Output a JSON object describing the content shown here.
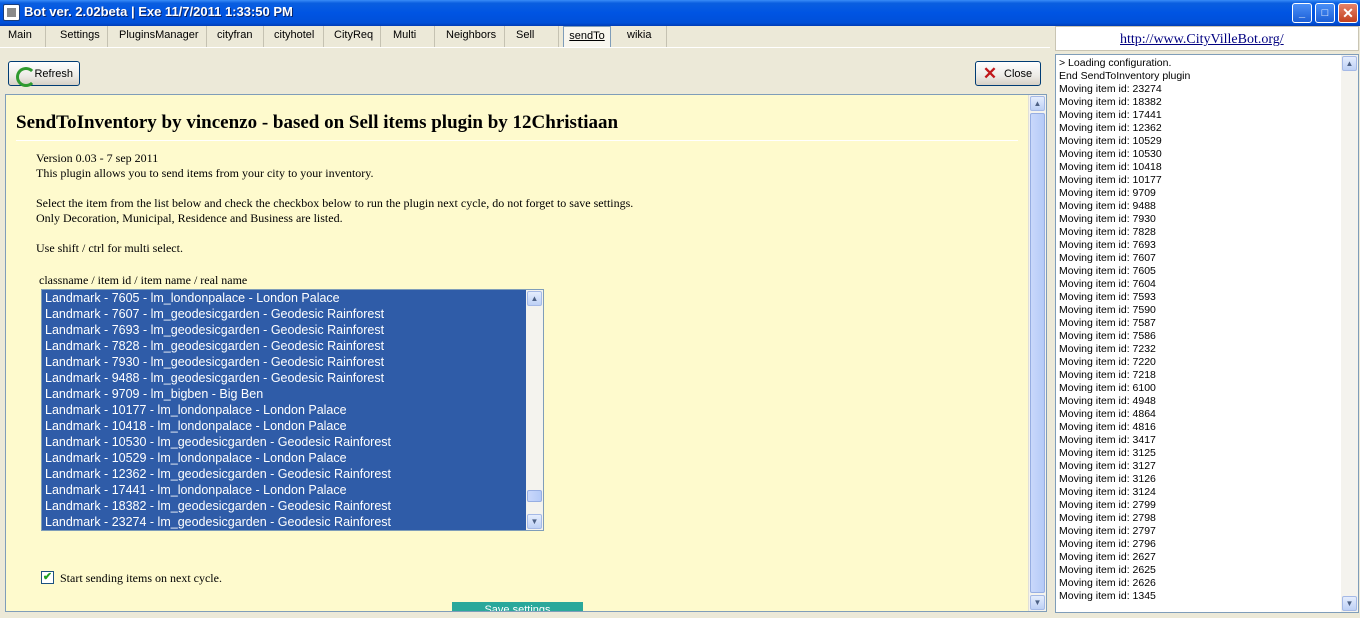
{
  "window": {
    "title": "Bot ver. 2.02beta  |  Exe 11/7/2011 1:33:50 PM",
    "minimize": "_",
    "maximize": "□",
    "close": "✕"
  },
  "tabs": [
    {
      "label": "Main"
    },
    {
      "label": "Settings"
    },
    {
      "label": "PluginsManager"
    },
    {
      "label": "cityfran"
    },
    {
      "label": "cityhotel"
    },
    {
      "label": "CityReq"
    },
    {
      "label": "Multi"
    },
    {
      "label": "Neighbors"
    },
    {
      "label": "Sell"
    },
    {
      "label": "sendTo",
      "selected": true
    },
    {
      "label": "wikia"
    }
  ],
  "toolbar": {
    "refresh_label": "Refresh",
    "close_label": "Close",
    "refresh_icon": "refresh-icon",
    "close_icon": "close-x-icon"
  },
  "plugin": {
    "title": "SendToInventory by vincenzo - based on Sell items plugin by 12Christiaan",
    "version": "Version 0.03 - 7 sep 2011",
    "description": "This plugin allows you to send items from your city to your inventory.",
    "instruction1": "Select the item from the list below and check the checkbox below to run the plugin next cycle, do not forget to save settings.",
    "instruction2": "Only Decoration, Municipal, Residence and Business are listed.",
    "instruction3": "Use shift / ctrl for multi select.",
    "list_header": "classname / item id / item name / real name",
    "items": [
      "Landmark - 7605 - lm_londonpalace - London Palace",
      "Landmark - 7607 - lm_geodesicgarden - Geodesic Rainforest",
      "Landmark - 7693 - lm_geodesicgarden - Geodesic Rainforest",
      "Landmark - 7828 - lm_geodesicgarden - Geodesic Rainforest",
      "Landmark - 7930 - lm_geodesicgarden - Geodesic Rainforest",
      "Landmark - 9488 - lm_geodesicgarden - Geodesic Rainforest",
      "Landmark - 9709 - lm_bigben - Big Ben",
      "Landmark - 10177 - lm_londonpalace - London Palace",
      "Landmark - 10418 - lm_londonpalace - London Palace",
      "Landmark - 10530 - lm_geodesicgarden - Geodesic Rainforest",
      "Landmark - 10529 - lm_londonpalace - London Palace",
      "Landmark - 12362 - lm_geodesicgarden - Geodesic Rainforest",
      "Landmark - 17441 - lm_londonpalace - London Palace",
      "Landmark - 18382 - lm_geodesicgarden - Geodesic Rainforest",
      "Landmark - 23274 - lm_geodesicgarden - Geodesic Rainforest"
    ],
    "checkbox_label": "Start sending items on next cycle.",
    "checkbox_checked": true,
    "save_label": "Save settings"
  },
  "sidebar": {
    "link": "http://www.CityVilleBot.org/",
    "log": [
      "> Loading configuration.",
      "End SendToInventory plugin",
      "Moving item id: 23274",
      "Moving item id: 18382",
      "Moving item id: 17441",
      "Moving item id: 12362",
      "Moving item id: 10529",
      "Moving item id: 10530",
      "Moving item id: 10418",
      "Moving item id: 10177",
      "Moving item id: 9709",
      "Moving item id: 9488",
      "Moving item id: 7930",
      "Moving item id: 7828",
      "Moving item id: 7693",
      "Moving item id: 7607",
      "Moving item id: 7605",
      "Moving item id: 7604",
      "Moving item id: 7593",
      "Moving item id: 7590",
      "Moving item id: 7587",
      "Moving item id: 7586",
      "Moving item id: 7232",
      "Moving item id: 7220",
      "Moving item id: 7218",
      "Moving item id: 6100",
      "Moving item id: 4948",
      "Moving item id: 4864",
      "Moving item id: 4816",
      "Moving item id: 3417",
      "Moving item id: 3125",
      "Moving item id: 3127",
      "Moving item id: 3126",
      "Moving item id: 3124",
      "Moving item id: 2799",
      "Moving item id: 2798",
      "Moving item id: 2797",
      "Moving item id: 2796",
      "Moving item id: 2627",
      "Moving item id: 2625",
      "Moving item id: 2626",
      "Moving item id: 1345"
    ]
  },
  "colors": {
    "titlebar": "#0054E3",
    "panel_bg": "#FEFACD",
    "selection": "#2F5CA8",
    "save_button": "#2AA89B"
  }
}
